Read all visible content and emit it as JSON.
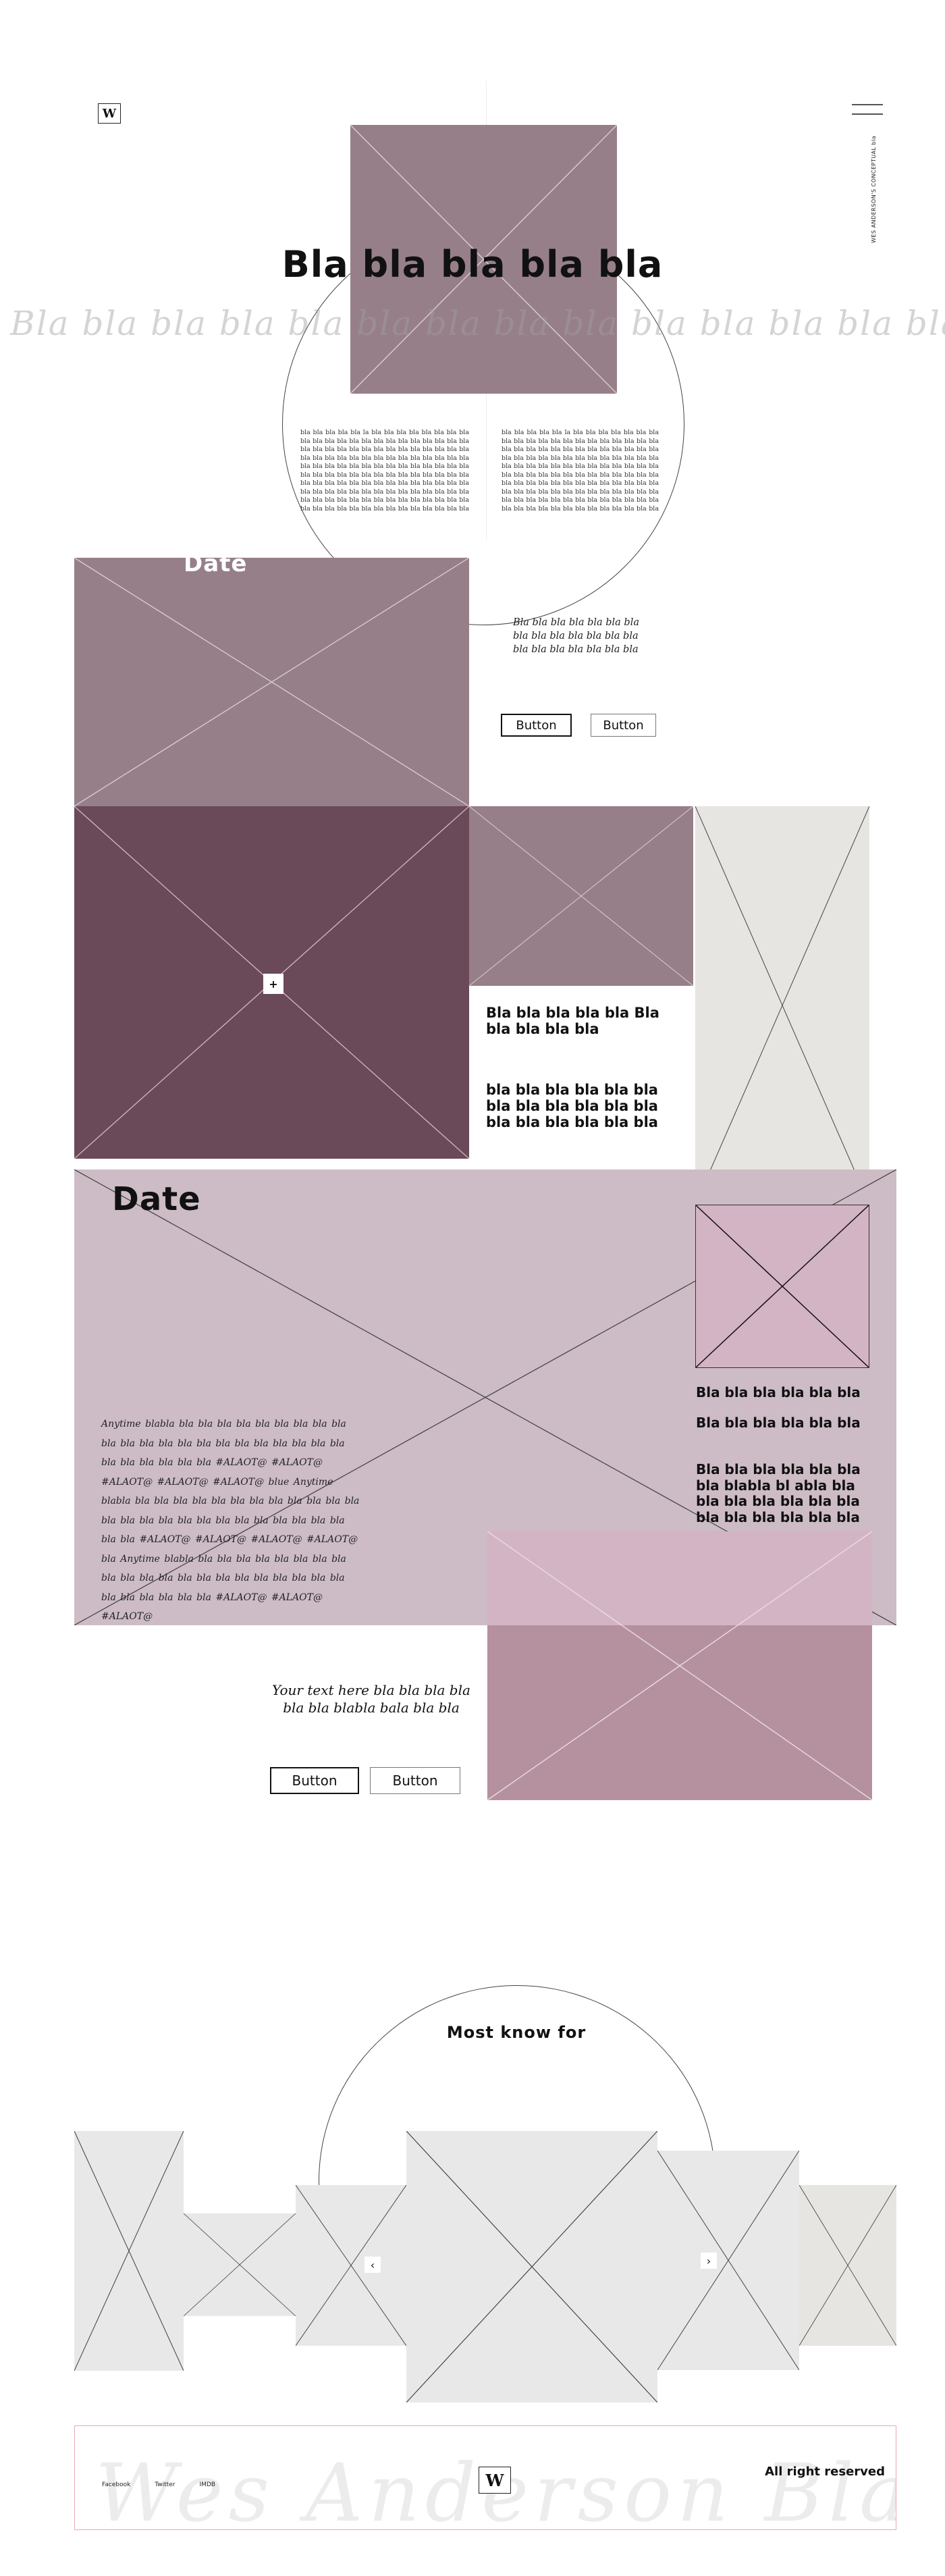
{
  "header": {
    "logo": "W",
    "menu_icon": "hamburger-icon",
    "vertical_text": "WES ANDERSON'S CONCEPTUAL bla"
  },
  "hero": {
    "title": "Bla bla bla bla bla",
    "marquee": "Bla bla bla bla bla bla bla bla bla bla bla bla bla bla blaa",
    "paragraph_left": "bla bla bla bla bla la bla bla bla bla bla bla bla bla bla bla bla bla bla bla bla bla bla bla bla bla bla bla bla bla bla bla bla bla bla bla bla bla bla bla bla bla bla bla bla bla bla bla bla bla bla bla bla bla bla bla bla bla bla bla bla bla bla bla bla bla bla bla bla bla bla bla bla bla bla bla bla bla bla bla bla bla bla bla bla bla bla bla bla bla bla bla bla bla bla bla bla bla bla bla bla bla bla bla bla bla bla bla bla bla bla bla bla bla bla bla bla bla bla bla bla bla bla bla bla bla bla bla bla bla bla bla bla bla bla bla bla bla bla bla bla bla bla bla bla bla bla bla bla bla bla bla bla bla bla bla bla bla bla bla bla bla bla bla bla bla bla bla bla bla bla bla bla bla bla bla bla bla bla bla bla bla",
    "paragraph_right": "bla bla bla bla bla la bla bla bla bla bla bla bla bla bla bla bla bla bla bla bla bla bla bla bla bla bla bla bla bla bla bla bla bla bla bla bla bla bla bla bla bla bla bla bla bla bla bla bla bla bla bla bla bla bla bla bla bla bla bla bla bla bla bla bla bla bla bla bla bla bla bla bla bla bla bla bla bla bla bla bla bla bla bla bla bla bla bla bla bla bla bla bla bla bla bla bla bla bla bla bla bla bla bla bla bla bla bla bla bla bla bla bla bla bla bla bla bla bla bla bla bla bla bla bla bla bla bla bla bla bla bla bla bla bla bla bla bla bla bla bla bla bla bla bla bla bla bla bla bla bla bla bla bla bla bla bla bla bla bla bla bla bla bla bla bla bla bla bla bla bla bla"
  },
  "section1": {
    "date_label": "Date",
    "script_text": "Bla bla bla bla bla bla bla bla bla bla bla bla bla bla bla bla bla bla bla bla bla",
    "button1": "Button",
    "button2": "Button",
    "plus": "+",
    "text1": "Bla bla bla bla bla Bla bla bla bla bla",
    "text2": "bla bla bla bla bla bla bla bla bla bla bla bla bla bla bla bla bla bla"
  },
  "section2": {
    "date_label": "Date",
    "script_paragraph": "Anytime blabla bla bla bla bla bla bla bla bla bla bla bla bla bla bla bla bla bla bla bla bla bla bla bla bla bla bla bla bla #ALAOT@ #ALAOT@ #ALAOT@ #ALAOT@ #ALAOT@ blue Anytime blabla bla bla bla bla bla bla bla bla bla bla bla bla bla bla bla bla bla bla bla bla bla bla bla bla bla bla bla #ALAOT@ #ALAOT@ #ALAOT@ #ALAOT@ bla Anytime blabla bla bla bla bla bla bla bla bla bla bla bla bla bla bla bla bla bla bla bla bla bla bla bla bla bla bla bla #ALAOT@ #ALAOT@ #ALAOT@",
    "caption": "Your text here bla bla bla bla bla bla blabla bala bla bla",
    "button1": "Button",
    "button2": "Button",
    "text1": "Bla bla bla bla bla bla",
    "text2": "Bla bla bla bla bla bla",
    "text3": "Bla bla bla bla bla bla bla blabla bl abla bla bla bla bla bla bla bla bla bla bla bla bla bla"
  },
  "carousel": {
    "title": "Most know for",
    "prev": "‹",
    "next": "›"
  },
  "footer": {
    "links": [
      "Facebook",
      "Twitter",
      "IMDB"
    ],
    "logo": "W",
    "watermark": "Wes Anderson Bla",
    "rights": "All right reserved"
  },
  "colors": {
    "mauve": "#977f8a",
    "plum": "#6a4958",
    "lilac": "#cdbcc5",
    "pink": "#d3b4c4",
    "dusty_rose": "#b5919f",
    "light_gray": "#e8e8e8",
    "warm_gray": "#e6e5e1",
    "footer_border": "#e8a9b2"
  }
}
